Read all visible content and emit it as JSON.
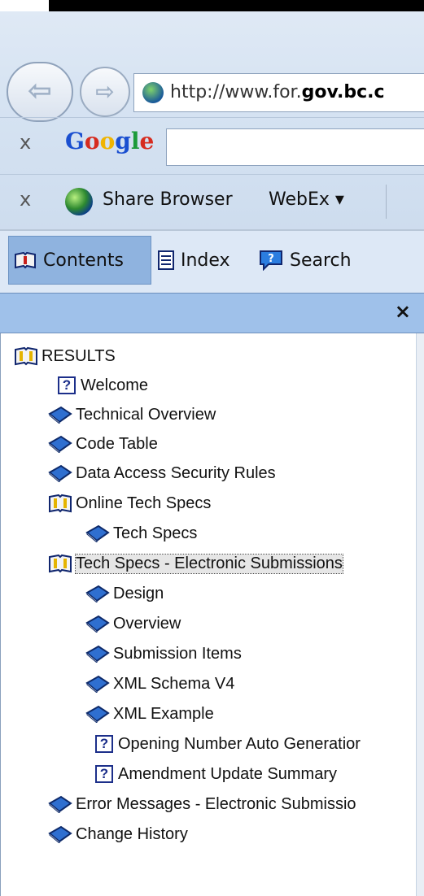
{
  "browser": {
    "url_prefix": "http://www.for.",
    "url_bold": "gov.bc.c",
    "toolbar_close": "x",
    "google_label": "Google",
    "share_browser_label": "Share Browser",
    "webex_label": "WebEx ▾"
  },
  "help_tabs": {
    "contents": "Contents",
    "index": "Index",
    "search": "Search"
  },
  "panel": {
    "close": "×"
  },
  "tree": [
    {
      "label": "RESULTS",
      "icon": "open-book-icon"
    },
    {
      "label": "Welcome",
      "icon": "help-page-icon"
    },
    {
      "label": "Technical Overview",
      "icon": "closed-book-icon"
    },
    {
      "label": "Code Table",
      "icon": "closed-book-icon"
    },
    {
      "label": "Data Access Security Rules",
      "icon": "closed-book-icon"
    },
    {
      "label": "Online Tech Specs",
      "icon": "open-book-icon"
    },
    {
      "label": "Tech Specs",
      "icon": "closed-book-icon"
    },
    {
      "label": "Tech Specs - Electronic Submissions",
      "icon": "open-book-icon",
      "selected": true
    },
    {
      "label": "Design",
      "icon": "closed-book-icon"
    },
    {
      "label": "Overview",
      "icon": "closed-book-icon"
    },
    {
      "label": "Submission Items",
      "icon": "closed-book-icon"
    },
    {
      "label": "XML Schema V4",
      "icon": "closed-book-icon"
    },
    {
      "label": "XML Example",
      "icon": "closed-book-icon"
    },
    {
      "label": "Opening Number Auto Generatior",
      "icon": "help-page-icon"
    },
    {
      "label": "Amendment Update Summary",
      "icon": "help-page-icon"
    },
    {
      "label": "Error Messages - Electronic Submissio",
      "icon": "closed-book-icon"
    },
    {
      "label": "Change History",
      "icon": "closed-book-icon"
    }
  ]
}
